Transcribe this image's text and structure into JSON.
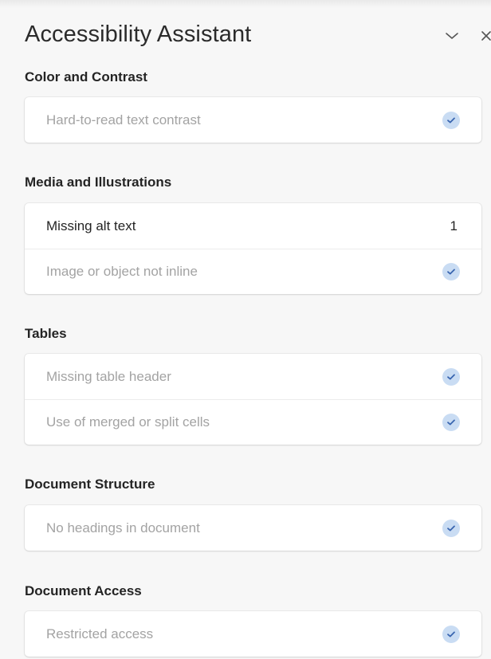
{
  "pane": {
    "title": "Accessibility Assistant",
    "collapse_icon": "chevron-down-icon",
    "close_icon": "close-icon"
  },
  "colors": {
    "check_bg": "#c9dcf3",
    "check_mark": "#3a66b0",
    "muted_text": "#a3a3a3",
    "text": "#242424"
  },
  "sections": [
    {
      "title": "Color and Contrast",
      "items": [
        {
          "label": "Hard-to-read text contrast",
          "status": "checked"
        }
      ]
    },
    {
      "title": "Media and Illustrations",
      "items": [
        {
          "label": "Missing alt text",
          "count": "1"
        },
        {
          "label": "Image or object not inline",
          "status": "checked"
        }
      ]
    },
    {
      "title": "Tables",
      "items": [
        {
          "label": "Missing table header",
          "status": "checked"
        },
        {
          "label": "Use of merged or split cells",
          "status": "checked"
        }
      ]
    },
    {
      "title": "Document Structure",
      "items": [
        {
          "label": "No headings in document",
          "status": "checked"
        }
      ]
    },
    {
      "title": "Document Access",
      "items": [
        {
          "label": "Restricted access",
          "status": "checked"
        }
      ]
    }
  ]
}
